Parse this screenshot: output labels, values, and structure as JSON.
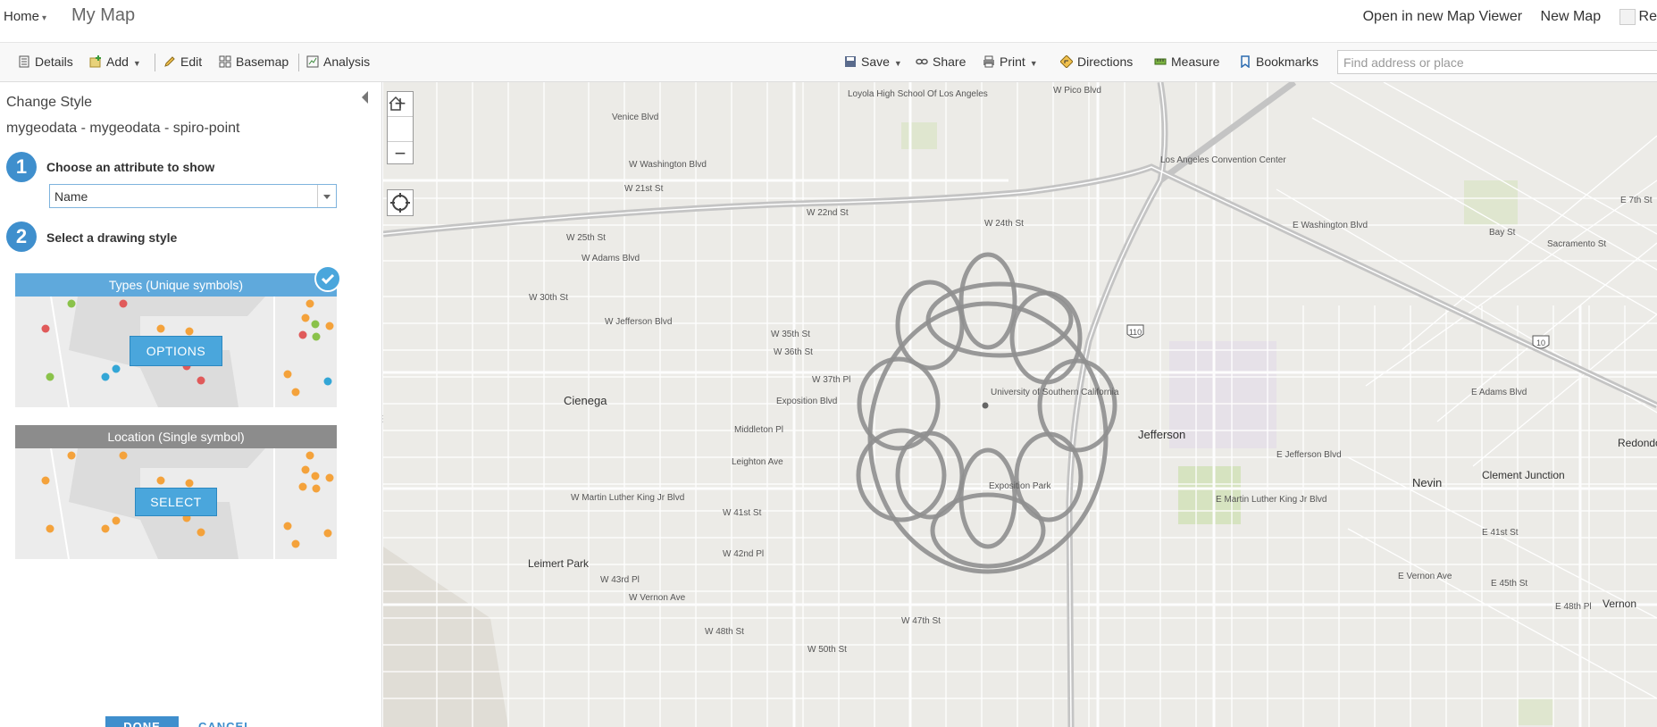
{
  "header": {
    "home_label": "Home",
    "title": "My Map",
    "links": [
      "Open in new Map Viewer",
      "New Map"
    ],
    "user_initial": "Re"
  },
  "toolbar": {
    "details": "Details",
    "add": "Add",
    "edit": "Edit",
    "basemap": "Basemap",
    "analysis": "Analysis",
    "save": "Save",
    "share": "Share",
    "print": "Print",
    "directions": "Directions",
    "measure": "Measure",
    "bookmarks": "Bookmarks",
    "search_placeholder": "Find address or place"
  },
  "panel": {
    "title": "Change Style",
    "layer": "mygeodata - mygeodata - spiro-point",
    "step1": {
      "number": "1",
      "label": "Choose an attribute to show"
    },
    "attribute_value": "Name",
    "step2": {
      "number": "2",
      "label": "Select a drawing style"
    },
    "cards": [
      {
        "title": "Types (Unique symbols)",
        "button": "OPTIONS",
        "selected": true
      },
      {
        "title": "Location (Single symbol)",
        "button": "SELECT",
        "selected": false
      }
    ],
    "done_label": "DONE",
    "cancel_label": "CANCEL"
  },
  "colors": {
    "accent": "#3f8fcd",
    "card_header_active": "#5fa9dc",
    "card_header_inactive": "#8c8c8c",
    "point_orange": "#f4a23b",
    "spiro_stroke": "#8f8f8f"
  },
  "map": {
    "place_labels": [
      "Cienega",
      "Jefferson",
      "Leimert Park",
      "Nevin",
      "Clement Junction",
      "Vernon",
      "Redondo Junction",
      "University of Southern California",
      "Exposition Park",
      "Los Angeles Convention Center",
      "Loyola High School Of Los Angeles"
    ],
    "street_labels": [
      "Venice Blvd",
      "W Pico Blvd",
      "W Washington Blvd",
      "W 21st St",
      "W 22nd St",
      "W 24th St",
      "W 25th St",
      "W Adams Blvd",
      "W 30th St",
      "W Jefferson Blvd",
      "W 35th St",
      "W 36th St",
      "W 37th Pl",
      "Exposition Blvd",
      "Middleton Pl",
      "Leighton Ave",
      "W Martin Luther King Jr Blvd",
      "W 41st St",
      "W 42nd Pl",
      "W 43rd Pl",
      "W Vernon Ave",
      "W 48th St",
      "W 50th St",
      "W 47th St",
      "E Washington Blvd",
      "E 41st St",
      "E 45th St",
      "E 48th Pl",
      "E Vernon Ave",
      "E Martin Luther King Jr Blvd",
      "E Adams Blvd",
      "E Jefferson Blvd",
      "Bay St",
      "Sacramento St",
      "E 7th St"
    ],
    "highway_shields": [
      "110",
      "10"
    ],
    "zoom_in": "+",
    "zoom_out": "−"
  }
}
